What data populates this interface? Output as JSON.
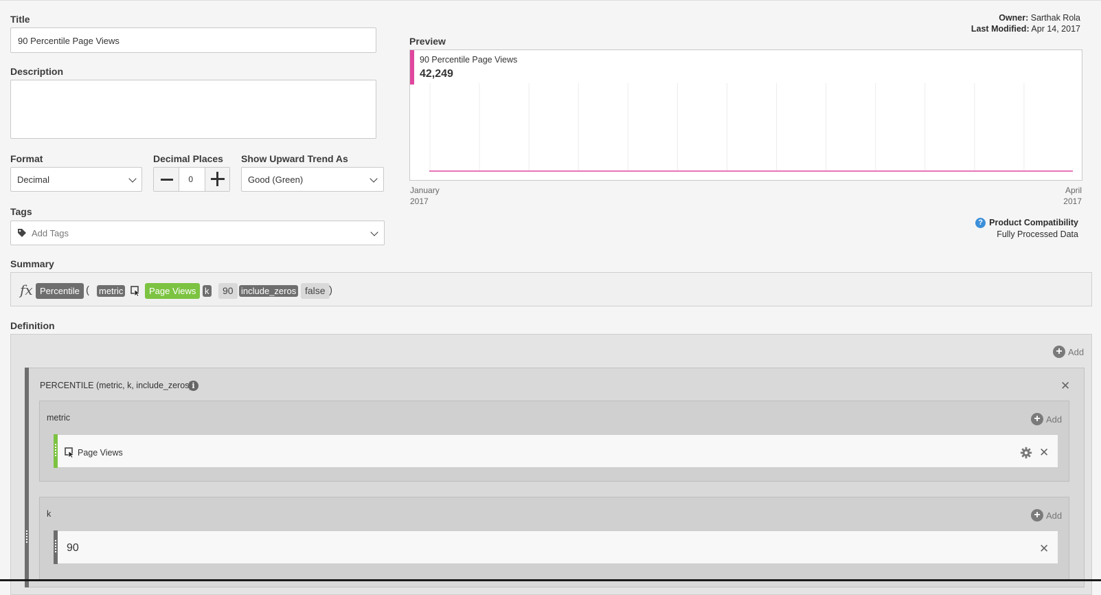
{
  "form": {
    "title_label": "Title",
    "title_value": "90 Percentile Page Views",
    "description_label": "Description",
    "description_value": "",
    "format_label": "Format",
    "format_value": "Decimal",
    "decimal_label": "Decimal Places",
    "decimal_value": "0",
    "trend_label": "Show Upward Trend As",
    "trend_value": "Good (Green)",
    "tags_label": "Tags",
    "tags_placeholder": "Add Tags"
  },
  "meta": {
    "owner_label": "Owner:",
    "owner_value": "Sarthak Rola",
    "modified_label": "Last Modified:",
    "modified_value": "Apr 14, 2017"
  },
  "preview": {
    "label": "Preview",
    "metric_name": "90 Percentile Page Views",
    "metric_value": "42,249",
    "x_start_month": "January",
    "x_start_year": "2017",
    "x_end_month": "April",
    "x_end_year": "2017",
    "line_color": "#e0479e"
  },
  "chart_data": {
    "type": "line",
    "series": [
      {
        "values": [
          0,
          0,
          0,
          0,
          0,
          0,
          0,
          0,
          0,
          0,
          0,
          0,
          0,
          0
        ]
      }
    ],
    "x_start": "January 2017",
    "x_end": "April 2017",
    "grid": true
  },
  "compat": {
    "title": "Product Compatibility",
    "value": "Fully Processed Data"
  },
  "summary": {
    "label": "Summary",
    "fx": "fx",
    "func": "Percentile",
    "open": "(",
    "arg1": "metric",
    "arg1_value": "Page Views",
    "arg2": "k",
    "arg2_value": "90",
    "arg3": "include_zeros",
    "arg3_value": "false",
    "close": ")"
  },
  "definition": {
    "label": "Definition",
    "add": "Add",
    "function_title": "PERCENTILE (metric, k, include_zeros)",
    "metric_section": "metric",
    "metric_item": "Page Views",
    "k_section": "k",
    "k_value": "90"
  }
}
